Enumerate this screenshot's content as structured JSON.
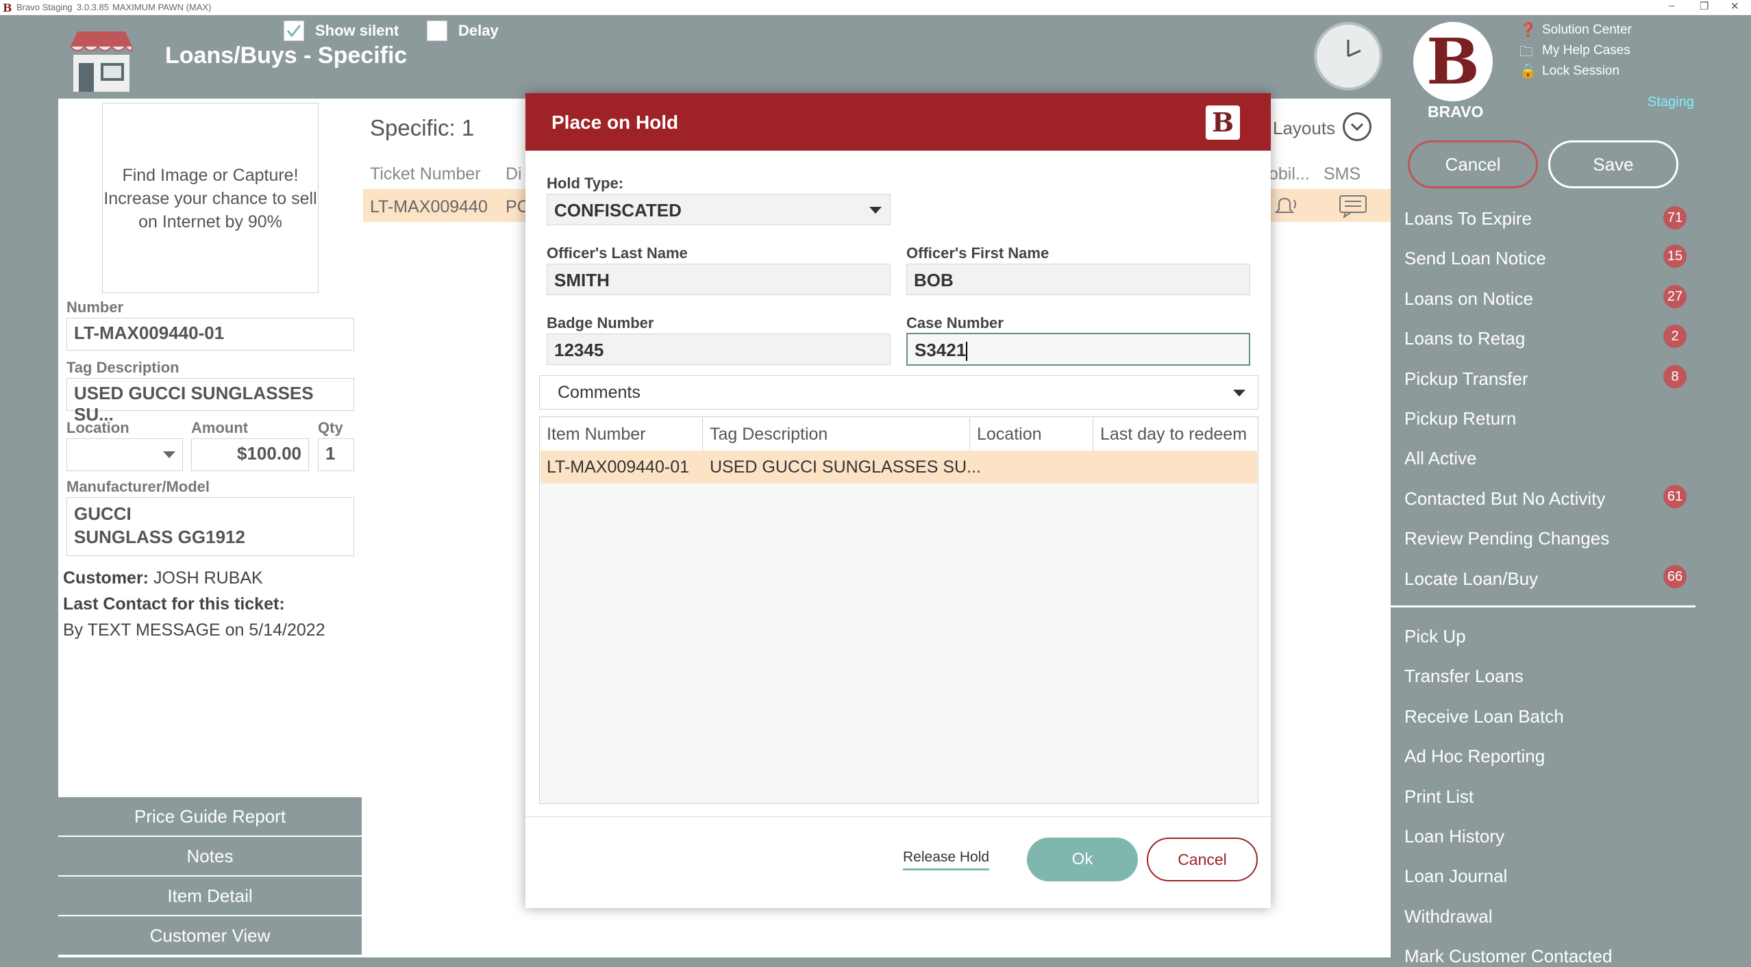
{
  "titlebar": {
    "app": "Bravo Staging",
    "version": "3.0.3.85",
    "store": "MAXIMUM PAWN (MAX)"
  },
  "header": {
    "title": "Loans/Buys - Specific",
    "show_silent": "Show silent",
    "delay": "Delay"
  },
  "left": {
    "image_prompt": [
      "Find Image or Capture!",
      "Increase your chance to sell",
      "on Internet by 90%"
    ],
    "number_label": "Number",
    "number": "LT-MAX009440-01",
    "tag_label": "Tag Description",
    "tag": "USED GUCCI SUNGLASSES SU...",
    "location_label": "Location",
    "amount_label": "Amount",
    "amount": "$100.00",
    "qty_label": "Qty",
    "qty": "1",
    "mfr_label": "Manufacturer/Model",
    "mfr1": "GUCCI",
    "mfr2": "SUNGLASS GG1912",
    "customer_label": "Customer:",
    "customer": "JOSH RUBAK",
    "last_contact_label": "Last Contact for this ticket:",
    "last_contact": "By TEXT MESSAGE on 5/14/2022",
    "buttons": [
      "Price Guide Report",
      "Notes",
      "Item Detail",
      "Customer View"
    ]
  },
  "center": {
    "specific": "Specific: 1",
    "layouts": "Layouts",
    "columns": [
      "Ticket Number",
      "Di",
      "obil...",
      "SMS"
    ],
    "row_ticket": "LT-MAX009440",
    "row_partial": "PC"
  },
  "dialog": {
    "title": "Place on Hold",
    "hold_type_label": "Hold Type:",
    "hold_type": "CONFISCATED",
    "last_name_label": "Officer's Last Name",
    "last_name": "SMITH",
    "first_name_label": "Officer's First Name",
    "first_name": "BOB",
    "badge_label": "Badge Number",
    "badge": "12345",
    "case_label": "Case Number",
    "case": "S3421",
    "comments": "Comments",
    "table_headers": [
      "Item Number",
      "Tag Description",
      "Location",
      "Last day to redeem"
    ],
    "rows": [
      {
        "item": "LT-MAX009440-01",
        "tag": "USED GUCCI SUNGLASSES SU...",
        "location": "",
        "last_day": ""
      }
    ],
    "release_hold": "Release Hold",
    "ok": "Ok",
    "cancel": "Cancel"
  },
  "right": {
    "brand": "BRAVO",
    "help": [
      "Solution Center",
      "My Help Cases",
      "Lock Session"
    ],
    "staging": "Staging",
    "cancel": "Cancel",
    "save": "Save",
    "menu": [
      {
        "label": "Loans To Expire",
        "badge": "71"
      },
      {
        "label": "Send Loan Notice",
        "badge": "15"
      },
      {
        "label": "Loans on Notice",
        "badge": "27"
      },
      {
        "label": "Loans to Retag",
        "badge": "2"
      },
      {
        "label": "Pickup Transfer",
        "badge": "8"
      },
      {
        "label": "Pickup Return",
        "badge": ""
      },
      {
        "label": "All Active",
        "badge": ""
      },
      {
        "label": "Contacted But No Activity",
        "badge": "61"
      },
      {
        "label": "Review Pending Changes",
        "badge": ""
      },
      {
        "label": "Locate Loan/Buy",
        "badge": "66"
      }
    ],
    "menu2": [
      "Pick Up",
      "Transfer Loans",
      "Receive Loan Batch",
      "Ad Hoc Reporting",
      "Print List",
      "Loan History",
      "Loan Journal",
      "Withdrawal",
      "Mark Customer Contacted"
    ]
  },
  "colors": {
    "accent": "#9e2226",
    "panel": "#8d9a9b",
    "highlight": "#fde3c6",
    "ok": "#7fb6ad"
  }
}
